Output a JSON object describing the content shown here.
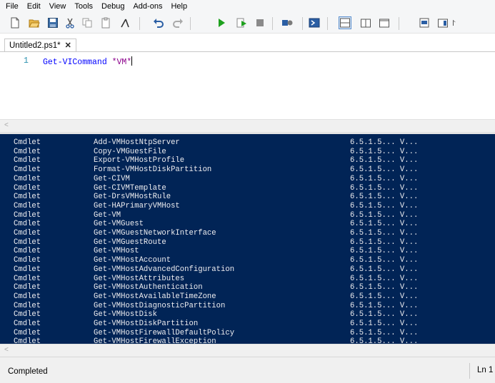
{
  "menu": [
    "File",
    "Edit",
    "View",
    "Tools",
    "Debug",
    "Add-ons",
    "Help"
  ],
  "toolbar": {
    "icons": [
      "new-script-icon",
      "open-icon",
      "save-icon",
      "cut-icon",
      "copy-icon",
      "paste-icon",
      "clear-console-icon",
      "undo-icon",
      "redo-icon",
      "run-icon",
      "run-selection-icon",
      "stop-icon",
      "remote-powershell-icon",
      "powershell-console-icon",
      "show-script-pane-top-icon",
      "show-script-pane-right-icon",
      "show-script-pane-maximized-icon",
      "show-script-pane-icon",
      "show-command-window-icon"
    ],
    "overflow": "⨡"
  },
  "tab": {
    "title": "Untitled2.ps1*",
    "close_glyph": "✕"
  },
  "editor": {
    "line_number": "1",
    "command": "Get-VICommand",
    "argument": "*VM*"
  },
  "console": {
    "rows": [
      [
        "Cmdlet",
        "Add-VMHostNtpServer",
        "6.5.1.5... V..."
      ],
      [
        "Cmdlet",
        "Copy-VMGuestFile",
        "6.5.1.5... V..."
      ],
      [
        "Cmdlet",
        "Export-VMHostProfile",
        "6.5.1.5... V..."
      ],
      [
        "Cmdlet",
        "Format-VMHostDiskPartition",
        "6.5.1.5... V..."
      ],
      [
        "Cmdlet",
        "Get-CIVM",
        "6.5.1.5... V..."
      ],
      [
        "Cmdlet",
        "Get-CIVMTemplate",
        "6.5.1.5... V..."
      ],
      [
        "Cmdlet",
        "Get-DrsVMHostRule",
        "6.5.1.5... V..."
      ],
      [
        "Cmdlet",
        "Get-HAPrimaryVMHost",
        "6.5.1.5... V..."
      ],
      [
        "Cmdlet",
        "Get-VM",
        "6.5.1.5... V..."
      ],
      [
        "Cmdlet",
        "Get-VMGuest",
        "6.5.1.5... V..."
      ],
      [
        "Cmdlet",
        "Get-VMGuestNetworkInterface",
        "6.5.1.5... V..."
      ],
      [
        "Cmdlet",
        "Get-VMGuestRoute",
        "6.5.1.5... V..."
      ],
      [
        "Cmdlet",
        "Get-VMHost",
        "6.5.1.5... V..."
      ],
      [
        "Cmdlet",
        "Get-VMHostAccount",
        "6.5.1.5... V..."
      ],
      [
        "Cmdlet",
        "Get-VMHostAdvancedConfiguration",
        "6.5.1.5... V..."
      ],
      [
        "Cmdlet",
        "Get-VMHostAttributes",
        "6.5.1.5... V..."
      ],
      [
        "Cmdlet",
        "Get-VMHostAuthentication",
        "6.5.1.5... V..."
      ],
      [
        "Cmdlet",
        "Get-VMHostAvailableTimeZone",
        "6.5.1.5... V..."
      ],
      [
        "Cmdlet",
        "Get-VMHostDiagnosticPartition",
        "6.5.1.5... V..."
      ],
      [
        "Cmdlet",
        "Get-VMHostDisk",
        "6.5.1.5... V..."
      ],
      [
        "Cmdlet",
        "Get-VMHostDiskPartition",
        "6.5.1.5... V..."
      ],
      [
        "Cmdlet",
        "Get-VMHostFirewallDefaultPolicy",
        "6.5.1.5... V..."
      ],
      [
        "Cmdlet",
        "Get-VMHostFirewallException",
        "6.5.1.5... V..."
      ]
    ]
  },
  "scroll_arrow": "<",
  "status": {
    "text": "Completed",
    "line": "Ln 1"
  },
  "colors": {
    "console_bg": "#012456",
    "console_fg": "#eeedf0",
    "keyword": "#0000ff",
    "string": "#8b008b"
  }
}
